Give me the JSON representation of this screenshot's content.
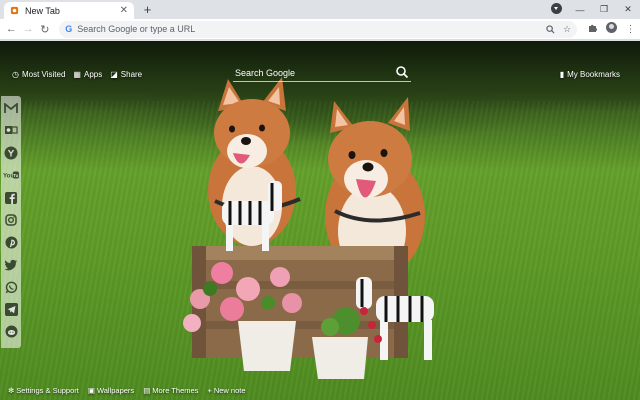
{
  "browser": {
    "tab": {
      "title": "New Tab",
      "close_icon": "close-icon",
      "favicon": "newtab-favicon"
    },
    "omnibox": {
      "placeholder": "Search Google or type a URL"
    }
  },
  "newtab": {
    "top_links": [
      {
        "label": "Most Visited",
        "icon": "clock-icon"
      },
      {
        "label": "Apps",
        "icon": "apps-grid-icon"
      },
      {
        "label": "Share",
        "icon": "share-icon"
      }
    ],
    "search": {
      "placeholder": "Search Google"
    },
    "bookmarks": {
      "label": "My Bookmarks",
      "icon": "bookmark-icon"
    },
    "sidebar": [
      {
        "name": "gmail",
        "icon": "gmail-icon"
      },
      {
        "name": "outlook",
        "icon": "outlook-icon"
      },
      {
        "name": "yahoo",
        "icon": "yahoo-icon"
      },
      {
        "name": "youtube",
        "icon": "youtube-icon"
      },
      {
        "name": "facebook",
        "icon": "facebook-icon"
      },
      {
        "name": "instagram",
        "icon": "instagram-icon"
      },
      {
        "name": "pinterest",
        "icon": "pinterest-icon"
      },
      {
        "name": "twitter",
        "icon": "twitter-icon"
      },
      {
        "name": "whatsapp",
        "icon": "whatsapp-icon"
      },
      {
        "name": "telegram",
        "icon": "telegram-icon"
      },
      {
        "name": "reddit",
        "icon": "reddit-icon"
      }
    ],
    "footer": [
      {
        "label": "Settings & Support",
        "icon": "gear-icon"
      },
      {
        "label": "Wallpapers",
        "icon": "image-icon"
      },
      {
        "label": "More Themes",
        "icon": "grid-icon"
      },
      {
        "label": "New note",
        "icon": "plus-icon"
      }
    ]
  },
  "colors": {
    "accent": "#4285f4",
    "chrome_bg": "#dee1e6",
    "text_on_bg": "#ffffff"
  }
}
